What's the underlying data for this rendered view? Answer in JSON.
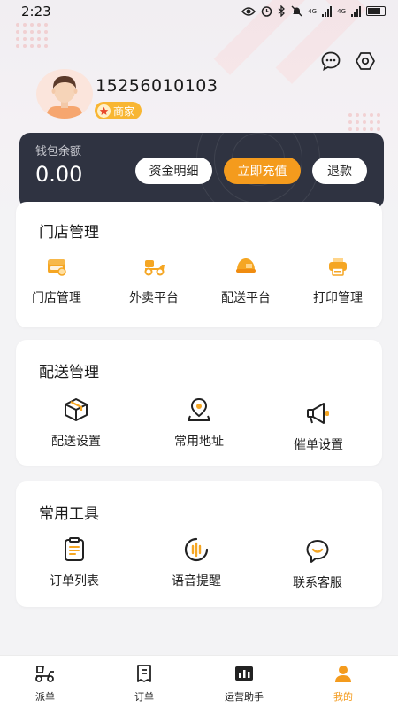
{
  "status_bar": {
    "time": "2:23",
    "network_a": "4G",
    "network_b": "4G"
  },
  "header": {
    "message_icon": "chat-bubble-icon",
    "settings_icon": "hexagon-settings-icon"
  },
  "profile": {
    "phone": "15256010103",
    "badge": "商家"
  },
  "wallet": {
    "label": "钱包余额",
    "amount": "0.00",
    "details_button": "资金明细",
    "recharge_button": "立即充值",
    "refund_button": "退款"
  },
  "sections": [
    {
      "title": "门店管理",
      "items": [
        {
          "label": "门店管理",
          "icon": "store-icon"
        },
        {
          "label": "外卖平台",
          "icon": "scooter-icon"
        },
        {
          "label": "配送平台",
          "icon": "helmet-icon"
        },
        {
          "label": "打印管理",
          "icon": "printer-icon"
        }
      ]
    },
    {
      "title": "配送管理",
      "items": [
        {
          "label": "配送设置",
          "icon": "package-icon"
        },
        {
          "label": "常用地址",
          "icon": "location-icon"
        },
        {
          "label": "催单设置",
          "icon": "megaphone-icon"
        }
      ]
    },
    {
      "title": "常用工具",
      "items": [
        {
          "label": "订单列表",
          "icon": "clipboard-icon"
        },
        {
          "label": "语音提醒",
          "icon": "voice-icon"
        },
        {
          "label": "联系客服",
          "icon": "customer-service-icon"
        }
      ]
    }
  ],
  "bottom_nav": [
    {
      "label": "派单",
      "icon": "dispatch-icon",
      "active": false
    },
    {
      "label": "订单",
      "icon": "order-icon",
      "active": false
    },
    {
      "label": "运营助手",
      "icon": "chart-icon",
      "active": false
    },
    {
      "label": "我的",
      "icon": "profile-icon",
      "active": true
    }
  ],
  "colors": {
    "accent": "#f49b1d",
    "wallet_bg": "#2f3341",
    "badge": "#f8b632",
    "icon_orange": "#f5a623"
  }
}
